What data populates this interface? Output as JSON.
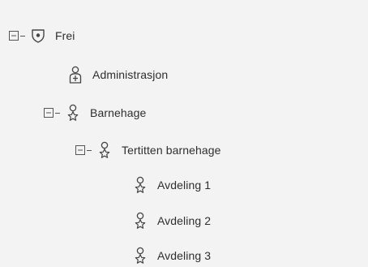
{
  "tree": {
    "root": {
      "label": "Frei",
      "expanded": true,
      "icon": "shield-icon"
    },
    "administrasjon": {
      "label": "Administrasjon",
      "icon": "unit-icon"
    },
    "barnehage": {
      "label": "Barnehage",
      "expanded": true,
      "icon": "group-star-icon"
    },
    "tertitten": {
      "label": "Tertitten barnehage",
      "expanded": true,
      "icon": "group-star-icon"
    },
    "avdelinger": [
      {
        "label": "Avdeling 1",
        "icon": "group-star-icon"
      },
      {
        "label": "Avdeling 2",
        "icon": "group-star-icon"
      },
      {
        "label": "Avdeling 3",
        "icon": "group-star-icon"
      }
    ]
  }
}
